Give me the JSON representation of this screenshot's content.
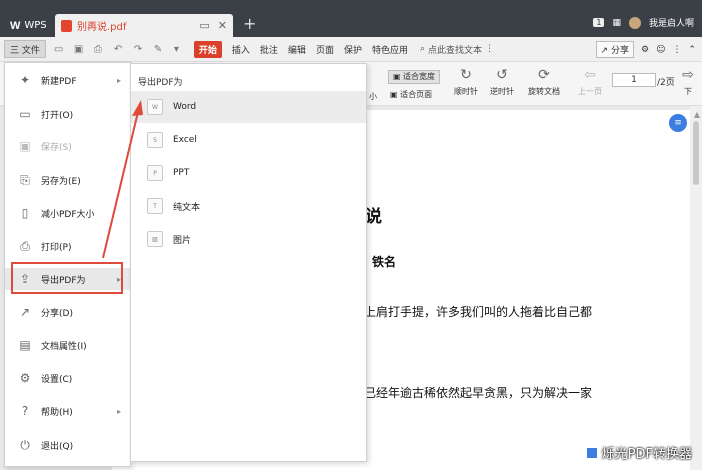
{
  "titlebar": {
    "app_label": "WPS",
    "doc_tab": "别再说.pdf",
    "new_tab": "+",
    "page_count_badge": "1",
    "user_name": "我是启人啊"
  },
  "menubar": {
    "file_label": "三 文件",
    "start": "开始",
    "items": [
      "插入",
      "批注",
      "编辑",
      "页面",
      "保护",
      "特色应用"
    ],
    "search": "点此查找文本",
    "share": "分享"
  },
  "toolbar": {
    "fit_width": "适合宽度",
    "fit_page": "适合页面",
    "size_partial": "小",
    "rotate_cw": "顺时针",
    "rotate_ccw": "逆时针",
    "rotate_doc": "旋转文档",
    "prev_page": "上一页",
    "page_input": "1",
    "page_total": "/2页",
    "next_partial": "下"
  },
  "document": {
    "title": "说",
    "subtitle": "铁名",
    "line1": "上肩打手提，许多我们叫的人拖着比自己都",
    "line2": "已经年逾古稀依然起早贪黑，只为解决一家"
  },
  "file_menu": {
    "items": [
      {
        "label": "新建PDF",
        "icon": "new-pdf-icon",
        "has_submenu": true
      },
      {
        "label": "打开(O)",
        "icon": "open-folder-icon",
        "has_submenu": false
      },
      {
        "label": "保存(S)",
        "icon": "save-icon",
        "has_submenu": false
      },
      {
        "label": "另存为(E)",
        "icon": "save-as-icon",
        "has_submenu": false
      },
      {
        "label": "减小PDF大小",
        "icon": "compress-icon",
        "has_submenu": false
      },
      {
        "label": "打印(P)",
        "icon": "printer-icon",
        "has_submenu": false
      },
      {
        "label": "导出PDF为",
        "icon": "export-icon",
        "has_submenu": true
      },
      {
        "label": "分享(D)",
        "icon": "share-icon",
        "has_submenu": false
      },
      {
        "label": "文档属性(I)",
        "icon": "properties-icon",
        "has_submenu": false
      },
      {
        "label": "设置(C)",
        "icon": "gear-icon",
        "has_submenu": false
      },
      {
        "label": "帮助(H)",
        "icon": "help-icon",
        "has_submenu": true
      },
      {
        "label": "退出(Q)",
        "icon": "exit-icon",
        "has_submenu": false
      }
    ]
  },
  "submenu": {
    "header": "导出PDF为",
    "items": [
      {
        "label": "Word",
        "icon": "word-icon"
      },
      {
        "label": "Excel",
        "icon": "excel-icon"
      },
      {
        "label": "PPT",
        "icon": "ppt-icon"
      },
      {
        "label": "纯文本",
        "icon": "text-icon"
      },
      {
        "label": "图片",
        "icon": "image-icon"
      }
    ]
  },
  "watermark": "烁光PDF转换器",
  "colors": {
    "titlebar": "#3b4047",
    "accent_red": "#d9412d",
    "highlight": "#e04a3b",
    "float_button": "#3b7de0"
  }
}
